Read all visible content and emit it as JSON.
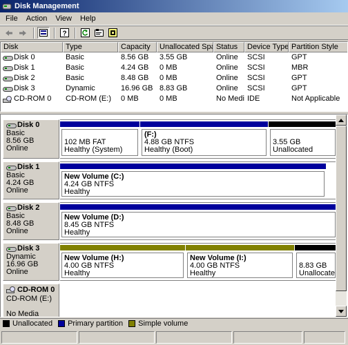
{
  "window": {
    "title": "Disk Management"
  },
  "menu": [
    {
      "label": "File"
    },
    {
      "label": "Action"
    },
    {
      "label": "View"
    },
    {
      "label": "Help"
    }
  ],
  "toolbar": {
    "icons": [
      "back-arrow-icon",
      "forward-arrow-icon",
      "disk-list-icon",
      "help-icon",
      "refresh-icon",
      "properties-icon",
      "rescan-icon"
    ]
  },
  "list": {
    "columns": [
      "Disk",
      "Type",
      "Capacity",
      "Unallocated Space",
      "Status",
      "Device Type",
      "Partition Style"
    ],
    "rows": [
      {
        "disk": "Disk 0",
        "type": "Basic",
        "capacity": "8.56 GB",
        "unallocated": "3.55 GB",
        "status": "Online",
        "device": "SCSI",
        "style": "GPT"
      },
      {
        "disk": "Disk 1",
        "type": "Basic",
        "capacity": "4.24 GB",
        "unallocated": "0 MB",
        "status": "Online",
        "device": "SCSI",
        "style": "MBR"
      },
      {
        "disk": "Disk 2",
        "type": "Basic",
        "capacity": "8.48 GB",
        "unallocated": "0 MB",
        "status": "Online",
        "device": "SCSI",
        "style": "GPT"
      },
      {
        "disk": "Disk 3",
        "type": "Dynamic",
        "capacity": "16.96 GB",
        "unallocated": "8.83 GB",
        "status": "Online",
        "device": "SCSI",
        "style": "GPT"
      },
      {
        "disk": "CD-ROM 0",
        "type": "CD-ROM (E:)",
        "capacity": "0 MB",
        "unallocated": "0 MB",
        "status": "No Media",
        "device": "IDE",
        "style": "Not Applicable"
      }
    ]
  },
  "disks": [
    {
      "name": "Disk 0",
      "type": "Basic",
      "size": "8.56 GB",
      "status": "Online",
      "partitions": [
        {
          "title": "",
          "line1": "102 MB FAT",
          "line2": "Healthy (System)",
          "kind": "primary"
        },
        {
          "title": "(F:)",
          "line1": "4.88 GB NTFS",
          "line2": "Healthy (Boot)",
          "kind": "primary"
        },
        {
          "title": "",
          "line1": "3.55 GB",
          "line2": "Unallocated",
          "kind": "unallocated"
        }
      ]
    },
    {
      "name": "Disk 1",
      "type": "Basic",
      "size": "4.24 GB",
      "status": "Online",
      "partitions": [
        {
          "title": "New Volume  (C:)",
          "line1": "4.24 GB NTFS",
          "line2": "Healthy",
          "kind": "primary"
        }
      ]
    },
    {
      "name": "Disk 2",
      "type": "Basic",
      "size": "8.48 GB",
      "status": "Online",
      "partitions": [
        {
          "title": "New Volume  (D:)",
          "line1": "8.45 GB NTFS",
          "line2": "Healthy",
          "kind": "primary"
        }
      ]
    },
    {
      "name": "Disk 3",
      "type": "Dynamic",
      "size": "16.96 GB",
      "status": "Online",
      "partitions": [
        {
          "title": "New Volume  (H:)",
          "line1": "4.00 GB NTFS",
          "line2": "Healthy",
          "kind": "simple"
        },
        {
          "title": "New Volume  (I:)",
          "line1": "4.00 GB NTFS",
          "line2": "Healthy",
          "kind": "simple"
        },
        {
          "title": "",
          "line1": "8.83 GB",
          "line2": "Unallocated",
          "kind": "unallocated"
        }
      ]
    },
    {
      "name": "CD-ROM 0",
      "type": "CD-ROM (E:)",
      "size": "",
      "status": "No Media",
      "partitions": []
    }
  ],
  "legend": [
    {
      "label": "Unallocated",
      "color": "#000000"
    },
    {
      "label": "Primary partition",
      "color": "#00009c"
    },
    {
      "label": "Simple volume",
      "color": "#808000"
    }
  ]
}
